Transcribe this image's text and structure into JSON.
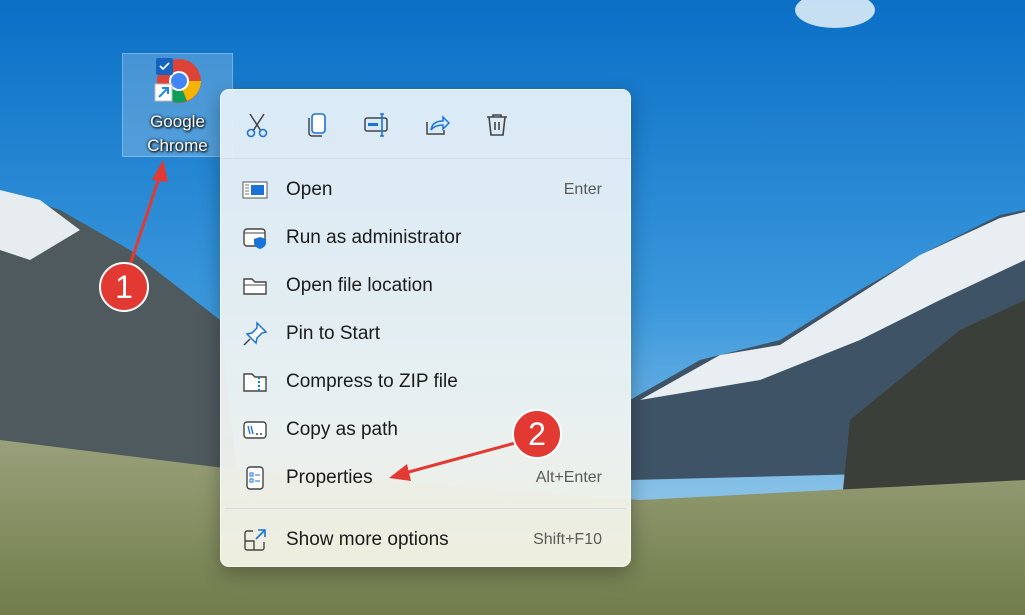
{
  "desktop": {
    "icon_label_line1": "Google",
    "icon_label_line2": "Chrome"
  },
  "toolbar": [
    "cut-icon",
    "copy-icon",
    "rename-icon",
    "share-icon",
    "delete-icon"
  ],
  "menu": {
    "items": [
      {
        "label": "Open",
        "shortcut": "Enter"
      },
      {
        "label": "Run as administrator",
        "shortcut": ""
      },
      {
        "label": "Open file location",
        "shortcut": ""
      },
      {
        "label": "Pin to Start",
        "shortcut": ""
      },
      {
        "label": "Compress to ZIP file",
        "shortcut": ""
      },
      {
        "label": "Copy as path",
        "shortcut": ""
      },
      {
        "label": "Properties",
        "shortcut": "Alt+Enter"
      }
    ],
    "more": {
      "label": "Show more options",
      "shortcut": "Shift+F10"
    }
  },
  "annotations": {
    "step1": "1",
    "step2": "2",
    "color": "#e23a33"
  }
}
